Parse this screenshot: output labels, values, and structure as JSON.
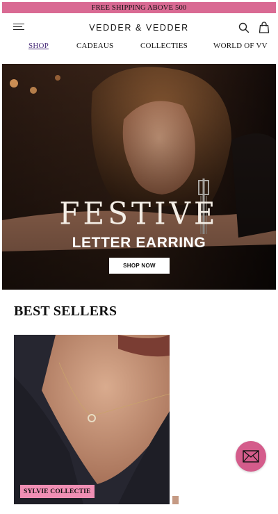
{
  "promo": {
    "text": "FREE SHIPPING ABOVE 500"
  },
  "header": {
    "logo": "VEDDER & VEDDER",
    "icons": {
      "menu": "hamburger-menu-icon",
      "search": "search-icon",
      "bag": "shopping-bag-icon"
    }
  },
  "nav": {
    "items": [
      {
        "label": "SHOP",
        "active": true
      },
      {
        "label": "CADEAUS",
        "active": false
      },
      {
        "label": "COLLECTIES",
        "active": false
      },
      {
        "label": "WORLD OF VV",
        "active": false
      }
    ]
  },
  "hero": {
    "title": "FESTIVE",
    "subtitle": "LETTER EARRING",
    "button": "SHOP NOW"
  },
  "best_sellers": {
    "title": "BEST SELLERS",
    "products": [
      {
        "tag": "SYLVIE COLLECTIE"
      }
    ]
  },
  "chat": {
    "icon": "envelope-icon"
  },
  "colors": {
    "promo_bg": "#d96a93",
    "nav_active": "#4a2e7a",
    "tag_bg": "#f08fb4",
    "chat_bg": "#d45c8b"
  }
}
